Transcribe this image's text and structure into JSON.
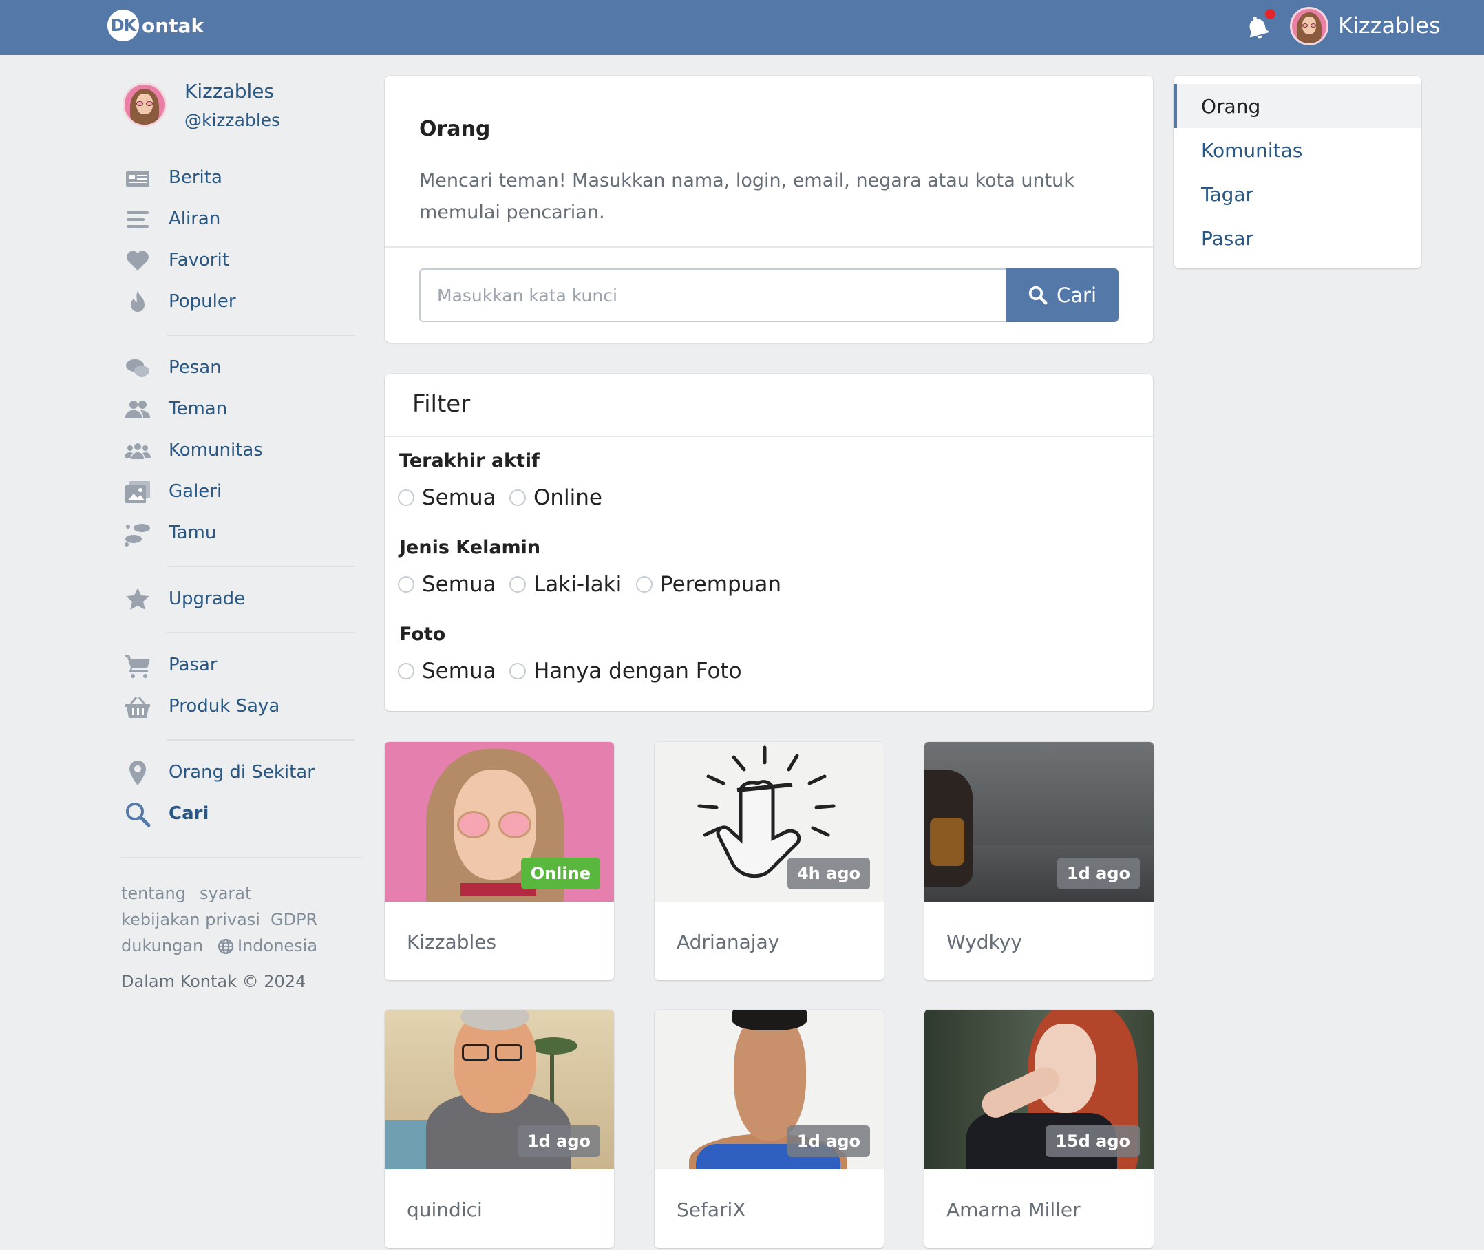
{
  "header": {
    "logo_badge": "DK",
    "logo_text": "ontak",
    "user_name": "Kizzables"
  },
  "profile": {
    "name": "Kizzables",
    "handle": "@kizzables"
  },
  "nav": {
    "items": [
      {
        "label": "Berita",
        "icon": "news-icon"
      },
      {
        "label": "Aliran",
        "icon": "stream-icon"
      },
      {
        "label": "Favorit",
        "icon": "heart-icon"
      },
      {
        "label": "Populer",
        "icon": "fire-icon"
      },
      {
        "label": "Pesan",
        "icon": "chat-icon"
      },
      {
        "label": "Teman",
        "icon": "friends-icon"
      },
      {
        "label": "Komunitas",
        "icon": "community-icon"
      },
      {
        "label": "Galeri",
        "icon": "gallery-icon"
      },
      {
        "label": "Tamu",
        "icon": "footprints-icon"
      },
      {
        "label": "Upgrade",
        "icon": "star-icon"
      },
      {
        "label": "Pasar",
        "icon": "cart-icon"
      },
      {
        "label": "Produk Saya",
        "icon": "basket-icon"
      },
      {
        "label": "Orang di Sekitar",
        "icon": "location-pin-icon"
      },
      {
        "label": "Cari",
        "icon": "search-icon"
      }
    ]
  },
  "footer": {
    "links": [
      "tentang",
      "syarat",
      "kebijakan privasi",
      "GDPR",
      "dukungan",
      "Indonesia"
    ],
    "copyright": "Dalam Kontak © 2024"
  },
  "search": {
    "title": "Orang",
    "description": "Mencari teman! Masukkan nama, login, email, negara atau kota untuk memulai pencarian.",
    "placeholder": "Masukkan kata kunci",
    "button_label": "Cari"
  },
  "filter": {
    "title": "Filter",
    "groups": [
      {
        "title": "Terakhir aktif",
        "options": [
          "Semua",
          "Online"
        ]
      },
      {
        "title": "Jenis Kelamin",
        "options": [
          "Semua",
          "Laki-laki",
          "Perempuan"
        ]
      },
      {
        "title": "Foto",
        "options": [
          "Semua",
          "Hanya dengan Foto"
        ]
      }
    ]
  },
  "people": [
    {
      "name": "Kizzables",
      "status": "Online"
    },
    {
      "name": "Adrianajay",
      "status": "4h ago"
    },
    {
      "name": "Wydkyy",
      "status": "1d ago"
    },
    {
      "name": "quindici",
      "status": "1d ago"
    },
    {
      "name": "SefariX",
      "status": "1d ago"
    },
    {
      "name": "Amarna Miller",
      "status": "15d ago"
    }
  ],
  "tabs": [
    "Orang",
    "Komunitas",
    "Tagar",
    "Pasar"
  ],
  "colors": {
    "brand": "#5479a8",
    "link": "#2a5885",
    "online": "#58b73c",
    "notification": "#e3262b"
  }
}
